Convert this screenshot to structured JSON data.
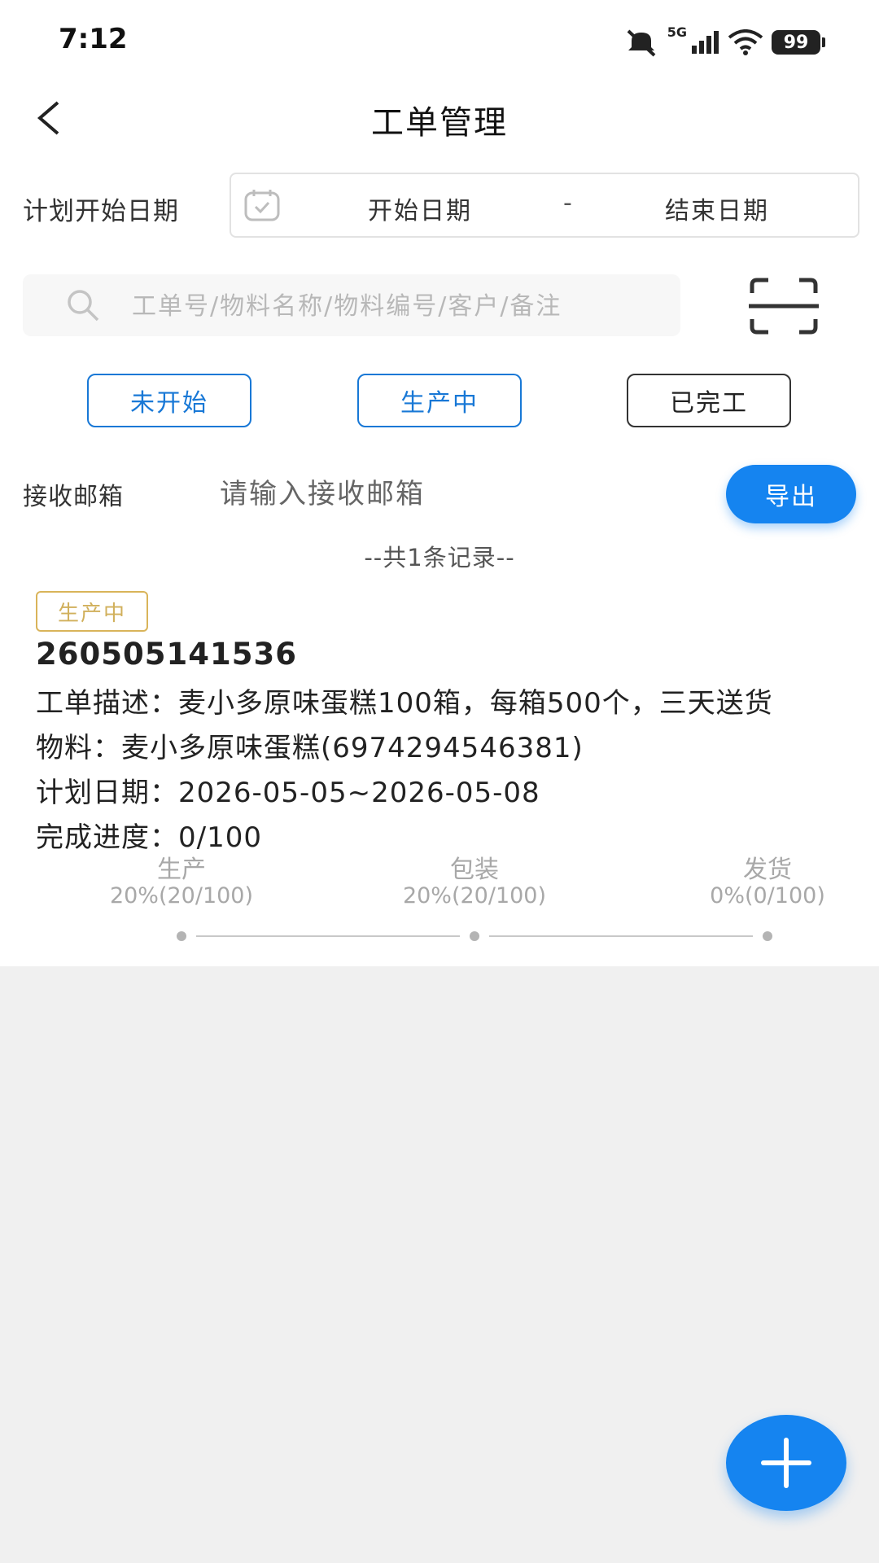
{
  "status_bar": {
    "time": "7:12",
    "battery": "99",
    "network": "5G",
    "icons": [
      "mute-icon",
      "signal-icon",
      "wifi-icon",
      "battery-icon"
    ]
  },
  "header": {
    "title": "工单管理",
    "back_icon": "chevron-left-icon"
  },
  "date_filter": {
    "label": "计划开始日期",
    "start_placeholder": "开始日期",
    "separator": "-",
    "end_placeholder": "结束日期",
    "icon": "calendar-icon"
  },
  "search": {
    "placeholder": "工单号/物料名称/物料编号/客户/备注",
    "value": "",
    "icon": "search-icon",
    "scan_icon": "scan-icon"
  },
  "status_filters": [
    {
      "label": "未开始"
    },
    {
      "label": "生产中"
    },
    {
      "label": "已完工"
    }
  ],
  "email": {
    "label": "接收邮箱",
    "placeholder": "请输入接收邮箱",
    "value": "",
    "export_label": "导出"
  },
  "record_count": "--共1条记录--",
  "work_order": {
    "status": "生产中",
    "order_no": "260505141536",
    "description": "工单描述：麦小多原味蛋糕100箱，每箱500个，三天送货",
    "material": "物料：麦小多原味蛋糕(6974294546381)",
    "plan_date": "计划日期：2026-05-05~2026-05-08",
    "progress": "完成进度：0/100",
    "steps": [
      {
        "name": "生产",
        "percent": "20%(20/100)"
      },
      {
        "name": "包装",
        "percent": "20%(20/100)"
      },
      {
        "name": "发货",
        "percent": "0%(0/100)"
      }
    ]
  },
  "fab": {
    "icon": "plus-icon"
  },
  "colors": {
    "primary": "#1584f0",
    "filter_blue": "#1878d6",
    "badge_gold": "#d9b45a",
    "page_bg": "#f0f0f0"
  }
}
